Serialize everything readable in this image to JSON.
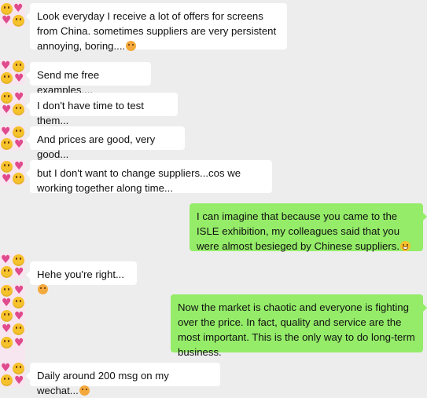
{
  "chat": {
    "messages": [
      {
        "side": "in",
        "text": "Look everyday I receive a lot of offers for screens from China. sometimes suppliers are very persistent annoying, boring....",
        "emoji": "hot-face-emoji"
      },
      {
        "side": "in",
        "text": "Send me free examples...."
      },
      {
        "side": "in",
        "text": "I don't have time to test them..."
      },
      {
        "side": "in",
        "text": "And prices are good, very good..."
      },
      {
        "side": "in",
        "text": "but I don't want to change suppliers...cos we working together along time..."
      },
      {
        "side": "out",
        "text": "I can imagine that because you came to the ISLE exhibition, my colleagues said that you were almost besieged by Chinese suppliers.",
        "emoji": "grimace-emoji"
      },
      {
        "side": "in",
        "text": "Hehe you're right...",
        "emoji": "hot-face-emoji"
      },
      {
        "side": "out",
        "text": "Now the market is chaotic and everyone is fighting over the price. In fact, quality and service are the most important. This is the only way to do long-term business."
      },
      {
        "side": "in",
        "text": "Daily around 200 msg on my wechat...",
        "emoji": "hot-face-emoji"
      }
    ]
  },
  "colors": {
    "background": "#ededed",
    "incoming_bubble": "#ffffff",
    "outgoing_bubble": "#95ec69"
  }
}
